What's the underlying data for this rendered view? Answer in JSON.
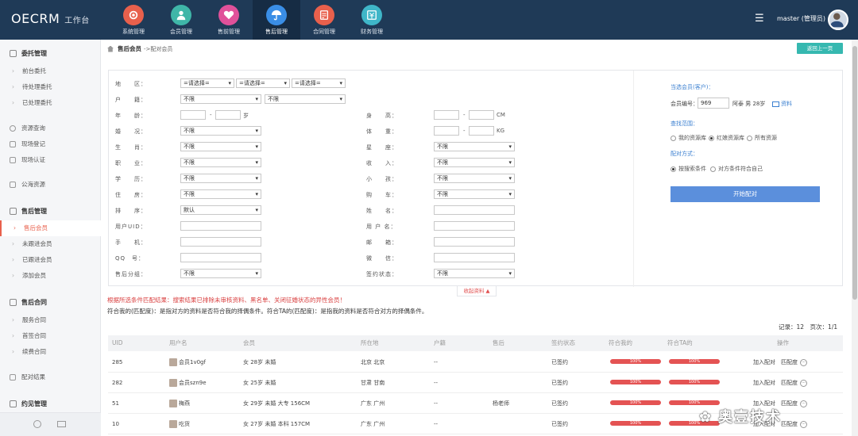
{
  "app": {
    "brand": "OECRM",
    "brand_sub": "工作台"
  },
  "nav": [
    {
      "label": "系统管理",
      "color": "#e8604c",
      "icon": "gear-icon"
    },
    {
      "label": "会员管理",
      "color": "#3fb6a8",
      "icon": "user-icon"
    },
    {
      "label": "售前管理",
      "color": "#e0519a",
      "icon": "heart-icon"
    },
    {
      "label": "售后管理",
      "color": "#3a8ee6",
      "icon": "umbrella-icon"
    },
    {
      "label": "合同管理",
      "color": "#e8604c",
      "icon": "contract-icon"
    },
    {
      "label": "财务管理",
      "color": "#3fb6c8",
      "icon": "finance-icon"
    }
  ],
  "header": {
    "menu_icon": "☰",
    "user": "master (管理员)"
  },
  "sidebar": {
    "g1": "委托管理",
    "g1_items": [
      "前台委托",
      "待处理委托",
      "已处理委托"
    ],
    "s1": [
      "资源查询",
      "现场登记",
      "现场认证"
    ],
    "s2": "公海资源",
    "g2": "售后管理",
    "g2_items": [
      "售后会员",
      "未跟进会员",
      "已跟进会员",
      "添加会员"
    ],
    "g3": "售后合同",
    "g3_items": [
      "服务合同",
      "首签合同",
      "续费合同"
    ],
    "s3": "配对结果",
    "g4": "约见管理"
  },
  "breadcrumb": {
    "current": "售后会员",
    "sub": "->配对会员"
  },
  "back_btn": "返回上一页",
  "form": {
    "region": "地　　区：",
    "region_opts": [
      "=请选择=",
      "=请选择=",
      "=请选择="
    ],
    "hukou": "户　　籍：",
    "hukou_opts": [
      "不限",
      "不限"
    ],
    "age": "年　　龄：",
    "age_unit": "岁",
    "dash": "-",
    "height": "身　　高：",
    "height_unit": "CM",
    "marriage": "婚　　况：",
    "marriage_val": "不限",
    "weight": "体　　重：",
    "weight_unit": "KG",
    "zodiac": "生　　肖：",
    "zodiac_val": "不限",
    "constellation": "星　　座：",
    "constellation_val": "不限",
    "job": "职　　业：",
    "job_val": "不限",
    "income": "收　　入：",
    "income_val": "不限",
    "edu": "学　　历：",
    "edu_val": "不限",
    "kids": "小　　孩：",
    "kids_val": "不限",
    "house": "住　　房：",
    "house_val": "不限",
    "car": "购　　车：",
    "car_val": "不限",
    "sort": "排　　序：",
    "sort_val": "默认",
    "name": "姓　　名：",
    "uid": "用户UID：",
    "username": "用 户 名：",
    "phone": "手　　机：",
    "email": "邮　　箱：",
    "qq": "QQ　号：",
    "wechat": "微　　信：",
    "after_group": "售后分组：",
    "after_group_val": "不限",
    "sign_status": "签约状态：",
    "sign_status_val": "不限"
  },
  "right": {
    "cur_title": "当选会员(客户)：",
    "member_no_label": "会员编号：",
    "member_no": "969",
    "member_info": "阿泰 男 28岁",
    "profile_link": "资料",
    "range_title": "查找范围：",
    "range_opts": [
      "我的资源库",
      "红娘资源库",
      "所有资源"
    ],
    "range_selected": 1,
    "method_title": "配对方式：",
    "method_opts": [
      "按搜索条件",
      "对方条件符合自己"
    ],
    "method_selected": 0,
    "match_btn": "开始配对"
  },
  "collapse": "收起资料 ▲",
  "notice_red": "根据所选条件匹配结果：搜索结果已排除未审核资料、黑名单、关闭征婚状态的异性会员！",
  "notice_black": "符合我的(匹配度)：是指对方的资料是否符合我的择偶条件。符合TA的(匹配度)：是指我的资料是否符合对方的择偶条件。",
  "records": "记录：12　页次：1/1",
  "table": {
    "headers": [
      "UID",
      "用户名",
      "会员",
      "所在地",
      "户籍",
      "售后",
      "签约状态",
      "符合我的",
      "符合TA的",
      "操作"
    ],
    "rows": [
      {
        "uid": "285",
        "user": "会员1v0gf",
        "member": "女 28岁 未婚",
        "loc": "北京 北京",
        "hukou": "--",
        "after": "",
        "status": "已签约",
        "me": 100,
        "ta": 100
      },
      {
        "uid": "282",
        "user": "会员szn9e",
        "member": "女 25岁 未婚",
        "loc": "甘肃 甘南",
        "hukou": "--",
        "after": "",
        "status": "已签约",
        "me": 100,
        "ta": 100
      },
      {
        "uid": "51",
        "user": "梅燕",
        "member": "女 29岁 未婚 大专 156CM",
        "loc": "广东 广州",
        "hukou": "--",
        "after": "杨老师",
        "status": "已签约",
        "me": 100,
        "ta": 100
      },
      {
        "uid": "10",
        "user": "吃货",
        "member": "女 27岁 未婚 本科 157CM",
        "loc": "广东 广州",
        "hukou": "--",
        "after": "",
        "status": "已签约",
        "me": 100,
        "ta": 100
      }
    ],
    "pct": "100%",
    "op_add": "加入配对",
    "op_match": "匹配度",
    "op_more": "···"
  },
  "watermark": "奥壹技术"
}
